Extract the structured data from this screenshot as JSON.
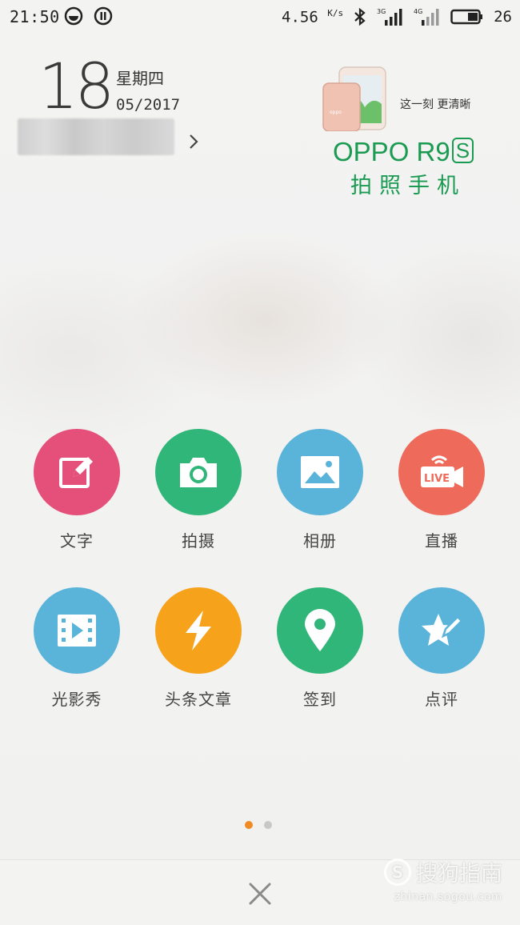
{
  "status_bar": {
    "time": "21:50",
    "net_speed": "4.56",
    "net_speed_unit": "K/s",
    "signal1_label": "3G",
    "signal2_label": "4G",
    "battery": "26"
  },
  "date": {
    "day": "18",
    "weekday": "星期四",
    "month_year": "05/2017"
  },
  "ad": {
    "tagline": "这一刻 更清晰",
    "model": "OPPO R9",
    "model_suffix": "S",
    "subtitle": "拍照手机"
  },
  "share_items": [
    {
      "label": "文字",
      "icon": "edit-icon",
      "color": "#e5507a"
    },
    {
      "label": "拍摄",
      "icon": "camera-icon",
      "color": "#30b679"
    },
    {
      "label": "相册",
      "icon": "image-icon",
      "color": "#5ab3d9"
    },
    {
      "label": "直播",
      "icon": "live-icon",
      "color": "#ee6b5c"
    },
    {
      "label": "光影秀",
      "icon": "video-icon",
      "color": "#5ab3d9"
    },
    {
      "label": "头条文章",
      "icon": "lightning-icon",
      "color": "#f7a21b"
    },
    {
      "label": "签到",
      "icon": "location-pin-icon",
      "color": "#30b679"
    },
    {
      "label": "点评",
      "icon": "star-pen-icon",
      "color": "#5ab3d9"
    }
  ],
  "pager": {
    "active_color": "#f08a24",
    "inactive_color": "#c8c8c8",
    "pages": 2,
    "current": 1
  },
  "watermark": {
    "logo_text": "S",
    "brand": "搜狗指南",
    "url": "zhinan.sogou.com"
  }
}
